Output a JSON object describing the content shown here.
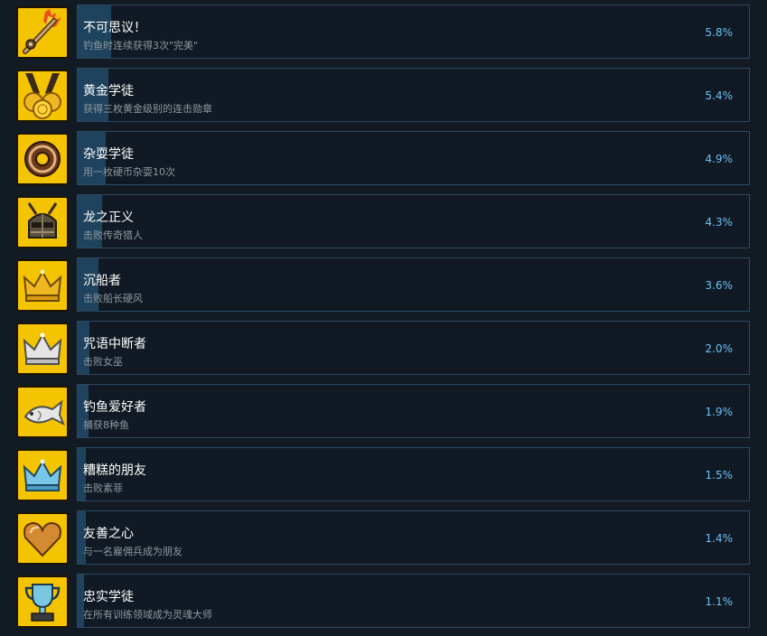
{
  "colors": {
    "background": "#121a24",
    "card_border": "#2a4a62",
    "progress_fill": "#1f435d",
    "icon_background": "#f5c400",
    "title_text": "#ffffff",
    "description_text": "#8f98a0",
    "percent_text": "#66c0f4"
  },
  "achievements": [
    {
      "title": "不可思议！",
      "description": "钓鱼时连续获得3次\"完美\"",
      "percent": "5.8%",
      "percent_value": 5.8,
      "icon": "fishing-rod-flame-icon"
    },
    {
      "title": "黄金学徒",
      "description": "获得三枚黄金级别的连击勋章",
      "percent": "5.4%",
      "percent_value": 5.4,
      "icon": "gold-medals-icon"
    },
    {
      "title": "杂耍学徒",
      "description": "用一枚硬币杂耍10次",
      "percent": "4.9%",
      "percent_value": 4.9,
      "icon": "coin-icon"
    },
    {
      "title": "龙之正义",
      "description": "击败传奇猎人",
      "percent": "4.3%",
      "percent_value": 4.3,
      "icon": "hunter-helmet-icon"
    },
    {
      "title": "沉船者",
      "description": "击败船长硬风",
      "percent": "3.6%",
      "percent_value": 3.6,
      "icon": "gold-crown-icon"
    },
    {
      "title": "咒语中断者",
      "description": "击败女巫",
      "percent": "2.0%",
      "percent_value": 2.0,
      "icon": "silver-crown-icon"
    },
    {
      "title": "钓鱼爱好者",
      "description": "捕获8种鱼",
      "percent": "1.9%",
      "percent_value": 1.9,
      "icon": "fish-icon"
    },
    {
      "title": "糟糕的朋友",
      "description": "击败素菲",
      "percent": "1.5%",
      "percent_value": 1.5,
      "icon": "blue-crown-icon"
    },
    {
      "title": "友善之心",
      "description": "与一名雇佣兵成为朋友",
      "percent": "1.4%",
      "percent_value": 1.4,
      "icon": "gold-heart-icon"
    },
    {
      "title": "忠实学徒",
      "description": "在所有训练领域成为灵魂大师",
      "percent": "1.1%",
      "percent_value": 1.1,
      "icon": "trophy-icon"
    }
  ]
}
